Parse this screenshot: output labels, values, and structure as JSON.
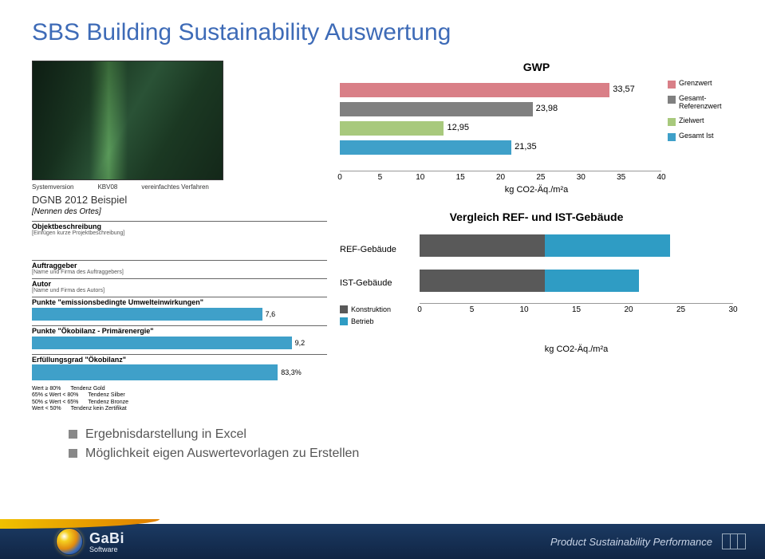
{
  "title": "SBS Building Sustainability Auswertung",
  "meta": {
    "col1_label": "Systemversion",
    "col2_label": "KBV08",
    "col3_label": "vereinfachtes Verfahren",
    "dgnb": "DGNB 2012 Beispiel",
    "ortes": "[Nennen des Ortes]"
  },
  "sections": {
    "obj_hdr": "Objektbeschreibung",
    "obj_sub": "[Einfügen kurze Projektbeschreibung]",
    "auftrag_hdr": "Auftraggeber",
    "auftrag_sub": "[Name und Firma des Auftraggebers]",
    "autor_hdr": "Autor",
    "autor_sub": "[Name und Firma des Autors]",
    "punkte1_hdr": "Punkte \"emissionsbedingte Umwelteinwirkungen\"",
    "punkte1_val": "7,6",
    "punkte2_hdr": "Punkte \"Ökobilanz - Primärenergie\"",
    "punkte2_val": "9,2",
    "erf_hdr": "Erfüllungsgrad \"Ökobilanz\"",
    "erf_val": "83,3%"
  },
  "legend_rows": [
    {
      "a": "Wert ≥ 80%",
      "b": "Tendenz Gold"
    },
    {
      "a": "65% ≤ Wert < 80%",
      "b": "Tendenz Silber"
    },
    {
      "a": "50% ≤ Wert < 65%",
      "b": "Tendenz Bronze"
    },
    {
      "a": "Wert < 50%",
      "b": "Tendenz kein Zertifikat"
    }
  ],
  "chart_data": [
    {
      "type": "bar",
      "title": "GWP",
      "orientation": "horizontal",
      "series": [
        {
          "name": "Grenzwert",
          "value": 33.57,
          "label": "33,57",
          "color": "#d97f87"
        },
        {
          "name": "Gesamt-Referenzwert",
          "value": 23.98,
          "label": "23,98",
          "color": "#808080"
        },
        {
          "name": "Zielwert",
          "value": 12.95,
          "label": "12,95",
          "color": "#a8c97d"
        },
        {
          "name": "Gesamt Ist",
          "value": 21.35,
          "label": "21,35",
          "color": "#3fa0c9"
        }
      ],
      "xlim": [
        0,
        40
      ],
      "xticks": [
        0,
        5,
        10,
        15,
        20,
        25,
        30,
        35,
        40
      ],
      "xlabel": "kg CO2-Äq./m²a",
      "legend": [
        "Grenzwert",
        "Gesamt-\nReferenzwert",
        "Zielwert",
        "Gesamt Ist"
      ]
    },
    {
      "type": "bar",
      "title": "Vergleich REF- und IST-Gebäude",
      "orientation": "horizontal",
      "stacked": true,
      "categories": [
        "REF-Gebäude",
        "IST-Gebäude"
      ],
      "series": [
        {
          "name": "Konstruktion",
          "values": [
            12,
            12
          ],
          "color": "#595959"
        },
        {
          "name": "Betrieb",
          "values": [
            12,
            9
          ],
          "color": "#2f9cc4"
        }
      ],
      "xlim": [
        0,
        30
      ],
      "xticks": [
        0,
        5,
        10,
        15,
        20,
        25,
        30
      ],
      "xlabel": "kg CO2-Äq./m²a"
    }
  ],
  "bullets": {
    "b1": "Ergebnisdarstellung in Excel",
    "b2": "Möglichkeit eigen Auswertevorlagen zu Erstellen"
  },
  "footer": {
    "brand": "GaBi",
    "brand_sub": "Software",
    "tagline": "Product Sustainability Performance"
  }
}
